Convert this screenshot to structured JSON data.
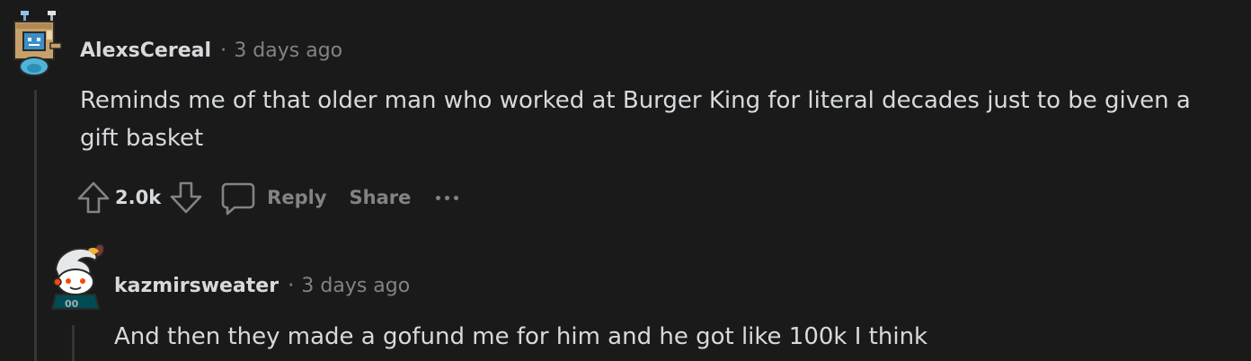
{
  "comments": [
    {
      "username": "AlexsCereal",
      "separator": "·",
      "timestamp": "3 days ago",
      "body": "Reminds me of that older man who worked at Burger King for literal decades just to be given a gift basket",
      "avatar_icon": "box-robot-avatar-icon",
      "actions": {
        "upvote_icon": "upvote-arrow-icon",
        "vote_count": "2.0k",
        "downvote_icon": "downvote-arrow-icon",
        "reply_icon": "speech-bubble-icon",
        "reply_label": "Reply",
        "share_label": "Share",
        "more_icon": "more-dots-icon"
      }
    },
    {
      "username": "kazmirsweater",
      "separator": "·",
      "timestamp": "3 days ago",
      "body": "And then they made a gofund me for him and he got like 100k I think",
      "avatar_icon": "snoo-eagles-avatar-icon"
    }
  ],
  "colors": {
    "background": "#1a1a1b",
    "text_primary": "#d7dadc",
    "text_secondary": "#818384",
    "thread_line": "#343536"
  }
}
